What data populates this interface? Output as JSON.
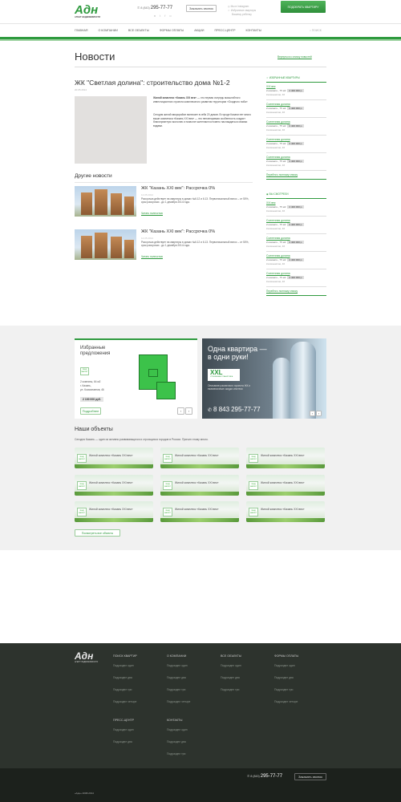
{
  "header": {
    "logo_text": "Адн",
    "logo_sub": "АГЕНТ НЕДВИЖИМОСТИ",
    "phone_prefix": "8 (843)",
    "phone": "295-77-77",
    "call_btn": "Заказать звонок",
    "social": [
      "vk-icon",
      "twitter-icon",
      "facebook-icon",
      "odnoklassniki-icon"
    ],
    "links": [
      "Мы в Instagram",
      "Избранные квартиры",
      "Вашему ребенку"
    ],
    "cta": "ПОДОБРАТЬ КВАРТИРУ"
  },
  "nav": {
    "items": [
      "ГЛАВНАЯ",
      "О КОМПАНИИ",
      "ВСЕ ОБЪЕКТЫ",
      "ФОРМЫ ОПЛАТЫ",
      "АКЦИИ",
      "ПРЕСС-ЦЕНТР",
      "КОНТАКТЫ"
    ],
    "search": "ПОИСК"
  },
  "page": {
    "title": "Новости",
    "back_link": "Вернуться к списку новостей"
  },
  "article": {
    "title": "ЖК \"Светлая долина\": строительство дома №1-2",
    "date": "20.05.2014",
    "lead_bold": "Жилой комплекс «Казань XXI век»",
    "lead": " — это первая очередь масштабного инвестиционного проекта комплексного развития территории «Осадного ноба»",
    "para": "Сегодня жилой микрорайон включает в себя 20 домов. В городе Казани нет много выше комплекса «Казань XXI век» — это неповторимая особенность создаст благоприятную экологию и позволит жителям постоянно наслаждаться своими видами."
  },
  "other": {
    "heading": "Другие новости",
    "items": [
      {
        "title": "ЖК \"Казань XXI век\": Рассрочка 0%",
        "date": "14.05.2014",
        "text": "Рассрочка действует на квартиры в домах №6.12 и 6.13. Первоначальный взнос – от 50%, срок рассрочки - до 1 декабря 2014 года.",
        "more": "Читать полностью"
      },
      {
        "title": "ЖК \"Казань XXI век\": Рассрочка 0%",
        "date": "14.05.2014",
        "text": "Рассрочка действует на квартиры в домах №6.12 и 6.13. Первоначальный взнос – от 50%, срок рассрочки - до 1 декабря 2014 года.",
        "more": "Читать полностью"
      }
    ]
  },
  "sidebar1": {
    "heading": "ИЗБРАННЫЕ КВАРТИРЫ",
    "items": [
      {
        "name": "XXI век",
        "desc": "2-комнатн., 75 м2",
        "price": "2 400 000 р.",
        "addr": "Космонавтов, 46"
      },
      {
        "name": "Солнечная долина",
        "desc": "2-комнатн., 75 м2",
        "price": "2 400 000 р.",
        "addr": "Космонавтов, 46"
      },
      {
        "name": "Солнечная долина",
        "desc": "2-комнатн., 75 м2",
        "price": "2 400 000 р.",
        "addr": "Космонавтов, 46"
      },
      {
        "name": "Солнечная долина",
        "desc": "2-комнатн., 75 м2",
        "price": "2 400 000 р.",
        "addr": "Космонавтов, 46"
      },
      {
        "name": "Солнечная долина",
        "desc": "2-комнатн., 75 м2",
        "price": "2 400 000 р.",
        "addr": "Космонавтов, 46"
      }
    ],
    "more": "Перейти к полному списку"
  },
  "sidebar2": {
    "heading": "ВЫ СМОТРЕЛИ",
    "items": [
      {
        "name": "XXI век",
        "desc": "2-комнатн., 75 м2",
        "price": "2 400 000 р.",
        "addr": "Космонавтов, 46"
      },
      {
        "name": "Солнечная долина",
        "desc": "2-комнатн., 75 м2",
        "price": "2 400 000 р.",
        "addr": "Космонавтов, 46"
      },
      {
        "name": "Солнечная долина",
        "desc": "2-комнатн., 75 м2",
        "price": "2 400 000 р.",
        "addr": "Космонавтов, 46"
      },
      {
        "name": "Солнечная долина",
        "desc": "2-комнатн., 75 м2",
        "price": "2 400 000 р.",
        "addr": "Космонавтов, 46"
      },
      {
        "name": "Солнечная долина",
        "desc": "2-комнатн., 75 м2",
        "price": "2 400 000 р.",
        "addr": "Космонавтов, 46"
      }
    ],
    "more": "Перейти к полному списку"
  },
  "featured": {
    "heading": "Избранные предложения",
    "brand": "ЛЕНД МАРКЕТ",
    "rooms": "2 комнаты, 64 м2",
    "city": "г. Казань,",
    "street": "ул. Космонавтов, 46",
    "price": "2 100 000 руб.",
    "more": "Подробнее"
  },
  "banner": {
    "line1": "Одна квартира —",
    "line2": "в одни руки!",
    "brand": "XXL",
    "brand_sub": "УЛУЧШЕННАЯ ПЛАНИРОВКА",
    "desc": "Описание различного проекта ЖК и ежемесячные скидки ипотеки",
    "phone_prefix": "8 843",
    "phone": "295-77-77"
  },
  "objects": {
    "heading": "Наши объекты",
    "intro": "Сегодня Казань — один из активно развивающихся и строящихся городов в России. Причин этому много.",
    "brand": "ЛЕНД МАРКЕТ",
    "items": [
      "Жилой комплекс «Казань XXI век»",
      "Жилой комплекс «Казань XXI век»",
      "Жилой комплекс «Казань XXI век»",
      "Жилой комплекс «Казань XXI век»",
      "Жилой комплекс «Казань XXI век»",
      "Жилой комплекс «Казань XXI век»",
      "Жилой комплекс «Казань XXI век»",
      "Жилой комплекс «Казань XXI век»",
      "Жилой комплекс «Казань XXI век»"
    ],
    "all": "Посмотреть все объекты"
  },
  "footer": {
    "cols": [
      {
        "h": "ПОИСК КВАРТИР",
        "l": [
          "Подраздел один",
          "Подраздел два",
          "Подраздел три",
          "Подраздел четыре"
        ]
      },
      {
        "h": "О КОМПАНИИ",
        "l": [
          "Подраздел один",
          "Подраздел два",
          "Подраздел три",
          "Подраздел четыре"
        ]
      },
      {
        "h": "ВСЕ ОБЪЕКТЫ",
        "l": [
          "Подраздел один",
          "Подраздел два",
          "Подраздел три"
        ]
      },
      {
        "h": "ФОРМЫ ОПЛАТЫ",
        "l": [
          "Подраздел один",
          "Подраздел два",
          "Подраздел три",
          "Подраздел четыре"
        ]
      },
      {
        "h": "ПРЕСС-ЦЕНТР",
        "l": [
          "Подраздел один",
          "Подраздел два"
        ]
      },
      {
        "h": "КОНТАКТЫ",
        "l": [
          "Подраздел один",
          "Подраздел два",
          "Подраздел три"
        ]
      }
    ],
    "copy": "«Адн» 2008-2014",
    "phone_prefix": "8 (843)",
    "phone": "295-77-77",
    "call_btn": "Заказать звонок"
  }
}
